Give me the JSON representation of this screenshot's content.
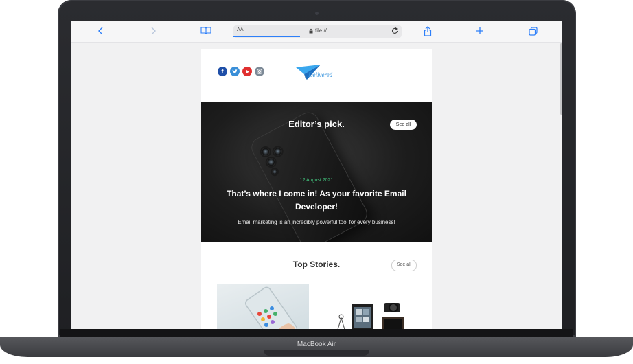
{
  "device": {
    "brand_label": "MacBook Air"
  },
  "browser": {
    "address_aa": "AA",
    "url": "file://",
    "icons": [
      "back-icon",
      "forward-icon",
      "book-icon",
      "lock-icon",
      "reload-icon",
      "share-icon",
      "new-tab-icon",
      "tabs-icon"
    ]
  },
  "email": {
    "social_icons": [
      "facebook-icon",
      "twitter-icon",
      "youtube-icon",
      "instagram-icon"
    ],
    "logo_text": "Delivered",
    "hero": {
      "title": "Editor’s pick.",
      "see_all": "See all",
      "date": "12 August 2021",
      "headline": "That’s where I come in! As your favorite Email Developer!",
      "subtext": "Email marketing is an incredibly powerful tool for every business!"
    },
    "top_stories": {
      "title": "Top Stories.",
      "see_all": "See all"
    }
  },
  "colors": {
    "accent": "#2d7ff9",
    "date_green": "#43c77f"
  }
}
